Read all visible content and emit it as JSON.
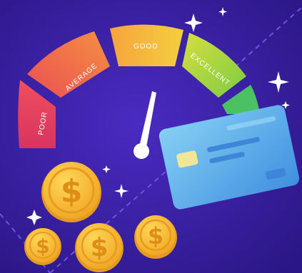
{
  "gauge": {
    "segments": [
      {
        "label": "POOR",
        "color": "#e0375f"
      },
      {
        "label": "AVERAGE",
        "color": "#f06a45"
      },
      {
        "label": "GOOD",
        "color": "#f4b43c"
      },
      {
        "label": "EXCELLENT",
        "color": "#a8d43c"
      },
      {
        "label": "",
        "color": "#49c064"
      }
    ]
  },
  "colors": {
    "background": "#3a1fa8",
    "card": "#5fb3ec",
    "coin": "#f4b830",
    "needle": "#ffffff"
  }
}
